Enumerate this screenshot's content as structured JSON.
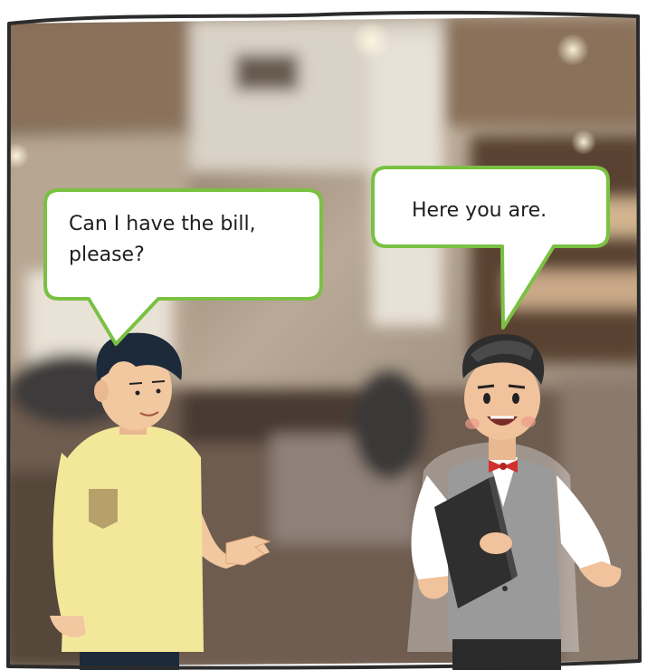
{
  "scene": {
    "border_color": "#2b2b2b",
    "bubble_outline_color": "#7ac143",
    "bubble_fill": "#ffffff"
  },
  "bubbles": {
    "customer": {
      "text": "Can I have the bill, please?"
    },
    "waiter": {
      "text": "Here you are."
    }
  },
  "characters": {
    "customer": {
      "shirt_color": "#f3e89a",
      "hair_color": "#1c2a3a"
    },
    "waiter": {
      "vest_color": "#9a9a9a",
      "bowtie_color": "#d0312d",
      "folder_color": "#2f2f2f"
    }
  }
}
